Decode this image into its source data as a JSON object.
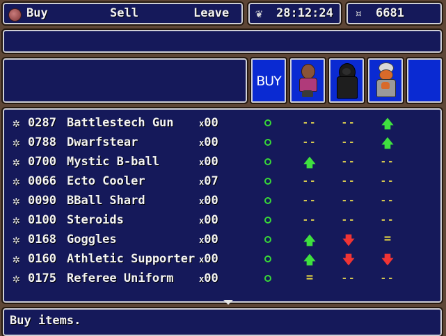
{
  "commands": {
    "buy": "Buy",
    "sell": "Sell",
    "leave": "Leave"
  },
  "status": {
    "time": "28:12:24",
    "money": "6681"
  },
  "shop": {
    "buy_label": "BUY"
  },
  "items": [
    {
      "code": "0287",
      "name": "Battlestech Gun",
      "qty_prefix": "x",
      "qty": "00",
      "c1": "dash",
      "c2": "dash",
      "c3": "up"
    },
    {
      "code": "0788",
      "name": "Dwarfstear",
      "qty_prefix": "x",
      "qty": "00",
      "c1": "dash",
      "c2": "dash",
      "c3": "up"
    },
    {
      "code": "0700",
      "name": "Mystic B-ball",
      "qty_prefix": "x",
      "qty": "00",
      "c1": "up",
      "c2": "dash",
      "c3": "dash"
    },
    {
      "code": "0066",
      "name": "Ecto Cooler",
      "qty_prefix": "x",
      "qty": "07",
      "c1": "dash",
      "c2": "dash",
      "c3": "dash"
    },
    {
      "code": "0090",
      "name": "BBall Shard",
      "qty_prefix": "x",
      "qty": "00",
      "c1": "dash",
      "c2": "dash",
      "c3": "dash"
    },
    {
      "code": "0100",
      "name": "Steroids",
      "qty_prefix": "x",
      "qty": "00",
      "c1": "dash",
      "c2": "dash",
      "c3": "dash"
    },
    {
      "code": "0168",
      "name": "Goggles",
      "qty_prefix": "x",
      "qty": "00",
      "c1": "up",
      "c2": "down",
      "c3": "eq"
    },
    {
      "code": "0160",
      "name": "Athletic Supporter",
      "qty_prefix": "x",
      "qty": "00",
      "c1": "up",
      "c2": "down",
      "c3": "down"
    },
    {
      "code": "0175",
      "name": "Referee Uniform",
      "qty_prefix": "x",
      "qty": "00",
      "c1": "eq",
      "c2": "dash",
      "c3": "dash"
    }
  ],
  "symbols": {
    "dash": "--",
    "up": "🡅",
    "down": "🡇",
    "eq": "="
  },
  "help": {
    "text": "Buy items."
  }
}
